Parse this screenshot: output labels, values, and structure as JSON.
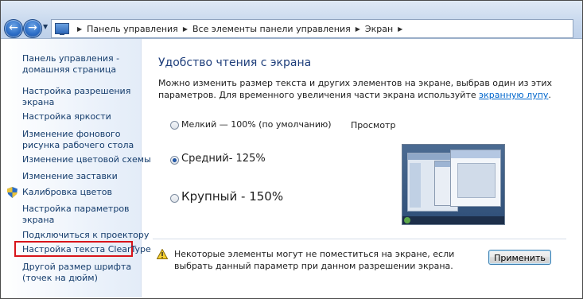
{
  "address_bar": {
    "path": [
      "Панель управления",
      "Все элементы панели управления",
      "Экран"
    ],
    "back_icon": "back-arrow-icon",
    "forward_icon": "forward-arrow-icon"
  },
  "sidebar": {
    "items": [
      {
        "line1": "Панель управления -",
        "line2": "домашняя страница"
      },
      {
        "line1": "Настройка разрешения",
        "line2": "экрана"
      },
      {
        "line1": "Настройка яркости",
        "line2": ""
      },
      {
        "line1": "Изменение фонового",
        "line2": "рисунка рабочего стола"
      },
      {
        "line1": "Изменение цветовой схемы",
        "line2": ""
      },
      {
        "line1": "Изменение заставки",
        "line2": ""
      },
      {
        "line1": "Калибровка цветов",
        "line2": "",
        "icon": "shield-icon"
      },
      {
        "line1": "Настройка параметров",
        "line2": "экрана"
      },
      {
        "line1": "Подключиться к проектору",
        "line2": ""
      },
      {
        "line1": "Настройка текста ClearType",
        "line2": "",
        "highlighted": true
      },
      {
        "line1": "Другой размер шрифта",
        "line2": "(точек на дюйм)"
      }
    ],
    "highlight_color": "#d8141a"
  },
  "main": {
    "title": "Удобство чтения с экрана",
    "description_part1": "Можно изменить размер текста и других элементов на экране, выбрав один из этих параметров. Для временного увеличения части экрана используйте ",
    "description_link": "экранную лупу",
    "description_part2": ".",
    "options": [
      {
        "label": "Мелкий — 100% (по умолчанию)",
        "checked": false
      },
      {
        "label": "Средний- 125%",
        "checked": true
      },
      {
        "label": "Крупный - 150%",
        "checked": false
      }
    ],
    "preview_label": "Просмотр",
    "warning": "Некоторые элементы могут не поместиться на экране, если выбрать данный параметр при данном разрешении экрана.",
    "apply_label": "Применить"
  },
  "colors": {
    "title": "#1e3e7b",
    "link": "#0066cc",
    "sidebar_link": "#143c6c"
  }
}
